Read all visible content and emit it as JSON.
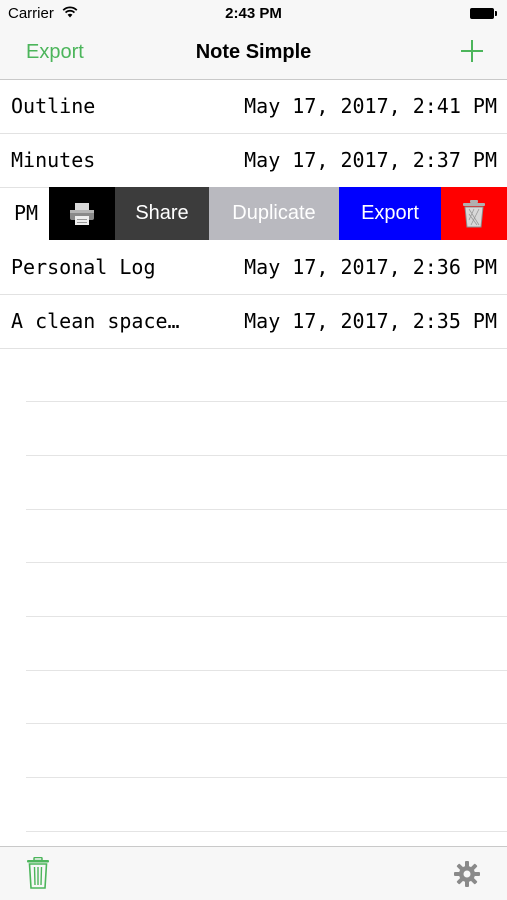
{
  "status_bar": {
    "carrier": "Carrier",
    "time": "2:43 PM"
  },
  "nav": {
    "export_label": "Export",
    "title": "Note Simple"
  },
  "notes": [
    {
      "title": "Outline",
      "date": "May 17, 2017, 2:41 PM"
    },
    {
      "title": "Minutes",
      "date": "May 17, 2017, 2:37 PM"
    },
    {
      "title": "Personal Log",
      "date": "May 17, 2017, 2:36 PM"
    },
    {
      "title": "A clean space…",
      "date": "May 17, 2017, 2:35 PM"
    }
  ],
  "swipe_row": {
    "visible_text": "PM",
    "actions": {
      "print_icon": "printer-icon",
      "share": "Share",
      "duplicate": "Duplicate",
      "export": "Export",
      "delete_icon": "trash-icon"
    }
  },
  "toolbar": {
    "left_icon": "trash-icon",
    "right_icon": "gear-icon"
  },
  "colors": {
    "accent": "#4cb55b",
    "print": "#000000",
    "share": "#3c3c3c",
    "duplicate": "#b9b9bf",
    "export": "#0000ff",
    "delete": "#ff0000"
  }
}
